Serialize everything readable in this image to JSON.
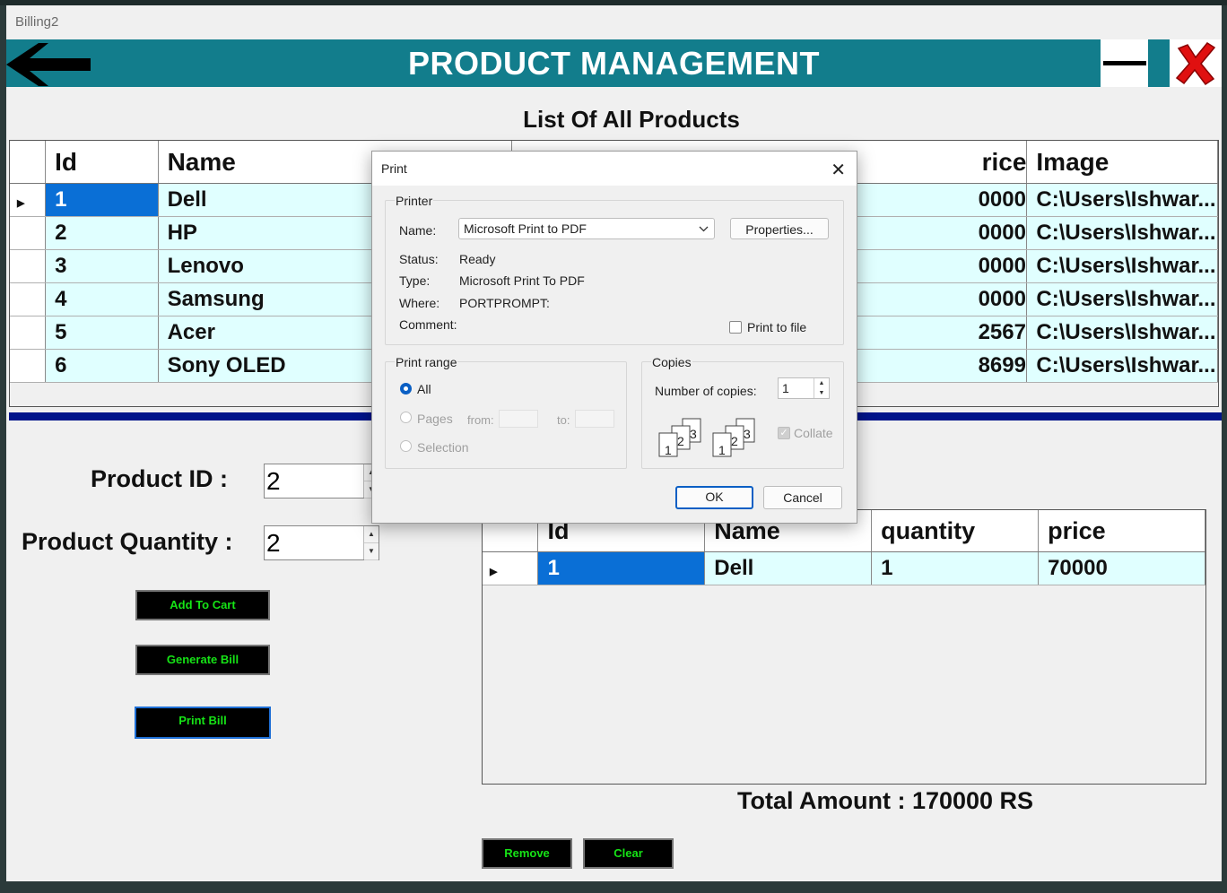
{
  "window": {
    "title": "Billing2"
  },
  "header": {
    "title": "PRODUCT MANAGEMENT"
  },
  "products": {
    "title": "List Of All Products",
    "columns": [
      "Id",
      "Name",
      "rice",
      "Image"
    ],
    "rows": [
      {
        "id": "1",
        "name": "Dell",
        "price": "0000",
        "image": "C:\\Users\\Ishwar..."
      },
      {
        "id": "2",
        "name": "HP",
        "price": "0000",
        "image": "C:\\Users\\Ishwar..."
      },
      {
        "id": "3",
        "name": "Lenovo",
        "price": "0000",
        "image": "C:\\Users\\Ishwar..."
      },
      {
        "id": "4",
        "name": "Samsung",
        "price": "0000",
        "image": "C:\\Users\\Ishwar..."
      },
      {
        "id": "5",
        "name": "Acer",
        "price": "2567",
        "image": "C:\\Users\\Ishwar..."
      },
      {
        "id": "6",
        "name": "Sony OLED",
        "price": "8699",
        "image": "C:\\Users\\Ishwar..."
      }
    ]
  },
  "form": {
    "product_id_label": "Product ID :",
    "product_id_value": "2",
    "quantity_label": "Product Quantity :",
    "quantity_value": "2",
    "add_to_cart": "Add To Cart",
    "generate_bill": "Generate Bill",
    "print_bill": "Print Bill"
  },
  "cart": {
    "columns": [
      "Id",
      "Name",
      "quantity",
      "price"
    ],
    "rows": [
      {
        "id": "1",
        "name": "Dell",
        "quantity": "1",
        "price": "70000"
      }
    ],
    "total": "Total Amount : 170000 RS",
    "remove": "Remove",
    "clear": "Clear"
  },
  "print_dialog": {
    "title": "Print",
    "printer_group": "Printer",
    "name_label": "Name:",
    "name_value": "Microsoft Print to PDF",
    "properties": "Properties...",
    "status_label": "Status:",
    "status_value": "Ready",
    "type_label": "Type:",
    "type_value": "Microsoft Print To PDF",
    "where_label": "Where:",
    "where_value": "PORTPROMPT:",
    "comment_label": "Comment:",
    "print_to_file": "Print to file",
    "range_group": "Print range",
    "range_all": "All",
    "range_pages": "Pages",
    "from_label": "from:",
    "to_label": "to:",
    "range_selection": "Selection",
    "copies_group": "Copies",
    "copies_label": "Number of copies:",
    "copies_value": "1",
    "collate": "Collate",
    "ok": "OK",
    "cancel": "Cancel"
  },
  "colors": {
    "header": "#127d8c",
    "row_bg": "#e0ffff",
    "selected": "#0a6fd6",
    "divider": "#00148a",
    "button_text": "#16e316"
  }
}
